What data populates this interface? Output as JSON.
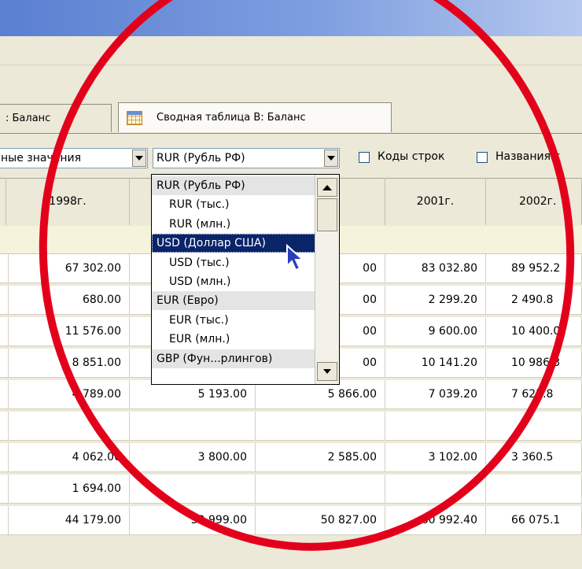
{
  "tabs": [
    {
      "label": ": Баланс"
    },
    {
      "label": "Сводная таблица В: Баланс"
    }
  ],
  "filters": {
    "values_combo": "ные значения",
    "currency_combo": "RUR (Рубль РФ)",
    "row_codes_label": "Коды строк",
    "row_names_label": "Названия с"
  },
  "columns": [
    "1998г.",
    "2001г.",
    "2002г."
  ],
  "currency_dropdown": {
    "items": [
      {
        "label": "RUR (Рубль РФ)",
        "kind": "group"
      },
      {
        "label": "RUR  (тыс.)",
        "kind": "sub"
      },
      {
        "label": "RUR  (млн.)",
        "kind": "sub"
      },
      {
        "label": "USD (Доллар США)",
        "kind": "selected"
      },
      {
        "label": "USD  (тыс.)",
        "kind": "sub"
      },
      {
        "label": "USD  (млн.)",
        "kind": "sub"
      },
      {
        "label": "EUR (Евро)",
        "kind": "group"
      },
      {
        "label": "EUR  (тыс.)",
        "kind": "sub"
      },
      {
        "label": "EUR  (млн.)",
        "kind": "sub"
      },
      {
        "label": "GBP (Фун...рлингов)",
        "kind": "group"
      }
    ]
  },
  "rows": [
    {
      "c1": "67 302.00",
      "c2": "",
      "c3": "00",
      "c4": "83 032.80",
      "c5": "89 952.2"
    },
    {
      "c1": "680.00",
      "c2": "",
      "c3": "00",
      "c4": "2 299.20",
      "c5": "2 490.8"
    },
    {
      "c1": "11 576.00",
      "c2": "",
      "c3": "00",
      "c4": "9 600.00",
      "c5": "10 400.0"
    },
    {
      "c1": "8 851.00",
      "c2": "",
      "c3": "00",
      "c4": "10 141.20",
      "c5": "10 986.3"
    },
    {
      "c1": "4 789.00",
      "c2": "5 193.00",
      "c3": "5 866.00",
      "c4": "7 039.20",
      "c5": "7 625.8"
    },
    {
      "c1": "",
      "c2": "",
      "c3": "",
      "c4": "",
      "c5": ""
    },
    {
      "c1": "4 062.00",
      "c2": "3 800.00",
      "c3": "2 585.00",
      "c4": "3 102.00",
      "c5": "3 360.5"
    },
    {
      "c1": "1 694.00",
      "c2": "",
      "c3": "",
      "c4": "",
      "c5": ""
    },
    {
      "c1": "44 179.00",
      "c2": "52 999.00",
      "c3": "50 827.00",
      "c4": "60 992.40",
      "c5": "66 075.1"
    }
  ],
  "colors": {
    "annotation_circle": "#e3001b",
    "selection": "#0a246a"
  }
}
